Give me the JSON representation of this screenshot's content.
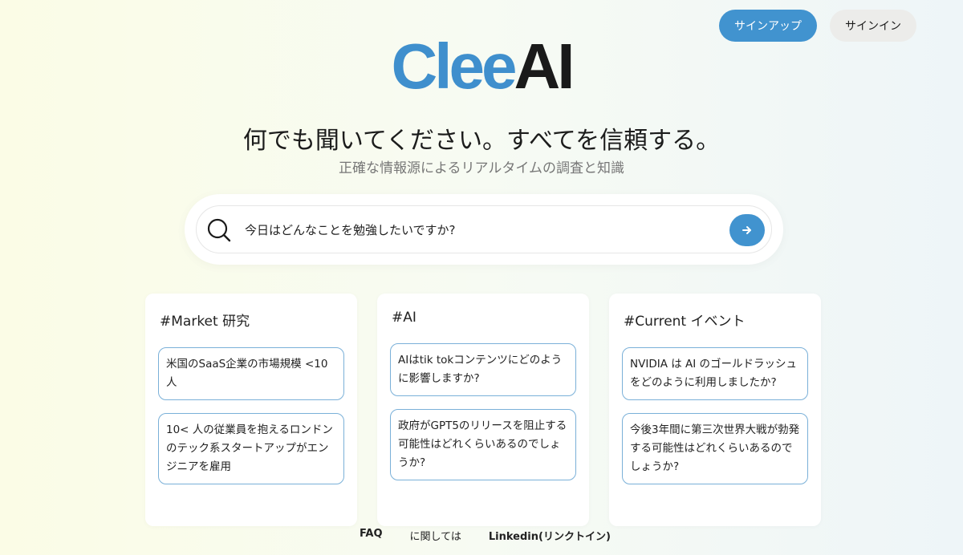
{
  "header": {
    "signup_label": "サインアップ",
    "signin_label": "サインイン"
  },
  "logo": {
    "part1": "Clee",
    "part2": "AI"
  },
  "hero": {
    "headline": "何でも聞いてください。すべてを信頼する。",
    "subline": "正確な情報源によるリアルタイムの調査と知識"
  },
  "search": {
    "placeholder": "今日はどんなことを勉強したいですか?",
    "value": ""
  },
  "cards": [
    {
      "title": "#Market 研究",
      "questions": [
        "米国のSaaS企業の市場規模 <10人",
        "10< 人の従業員を抱えるロンドンのテック系スタートアップがエンジニアを雇用"
      ]
    },
    {
      "title": "#AI",
      "questions": [
        "AIはtik tokコンテンツにどのように影響しますか?",
        "政府がGPT5のリリースを阻止する可能性はどれくらいあるのでしょうか?"
      ]
    },
    {
      "title": "#Current イベント",
      "questions": [
        "NVIDIA は AI のゴールドラッシュをどのように利用しましたか?",
        "今後3年間に第三次世界大戦が勃発する可能性はどれくらいあるのでしょうか?"
      ]
    }
  ],
  "footer": {
    "faq": "FAQ",
    "about": "に関しては",
    "linkedin": "Linkedin(リンクトイン)"
  },
  "colors": {
    "accent": "#4193cf",
    "logo_blue": "#3f8fcd",
    "card_border": "#7ab0d8"
  },
  "icons": {
    "search": "search-icon",
    "submit": "arrow-right-icon"
  }
}
